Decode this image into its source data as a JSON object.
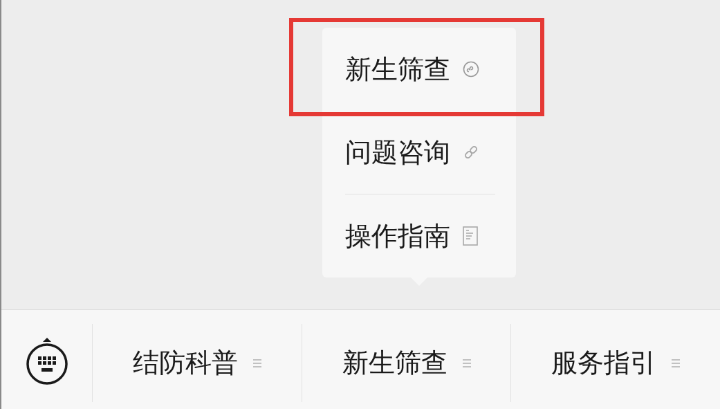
{
  "menu_popup": {
    "items": [
      {
        "label": "新生筛查",
        "kind": "miniprogram",
        "highlighted": true,
        "divider_above": false
      },
      {
        "label": "问题咨询",
        "kind": "link",
        "highlighted": false,
        "divider_above": false
      },
      {
        "label": "操作指南",
        "kind": "article",
        "highlighted": false,
        "divider_above": true
      }
    ]
  },
  "menu_bar": {
    "items": [
      {
        "label": "结防科普"
      },
      {
        "label": "新生筛查"
      },
      {
        "label": "服务指引"
      }
    ]
  }
}
